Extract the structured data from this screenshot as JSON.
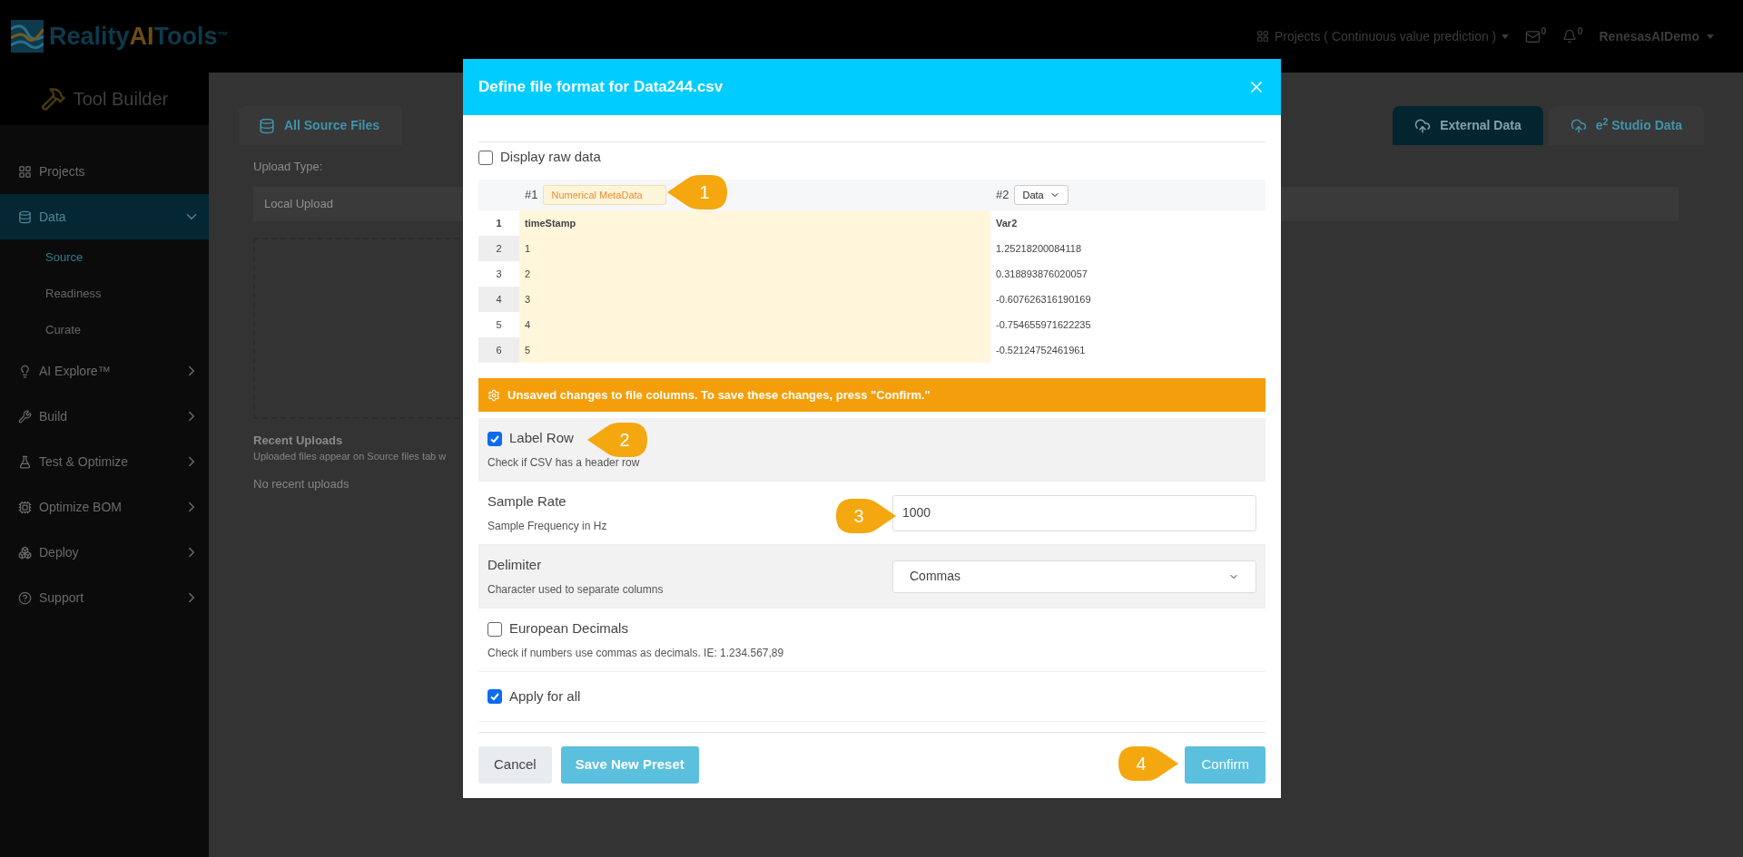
{
  "header": {
    "logo": {
      "parts": [
        "Reality",
        "AI",
        "Tools"
      ],
      "mark": "™"
    },
    "project_menu": "Projects ( Continuous value prediction )",
    "mail_count": "0",
    "notification_count": "0",
    "user": "RenesasAIDemo"
  },
  "sidebar": {
    "title": "Tool Builder",
    "items": [
      {
        "label": "Projects",
        "kind": "plain",
        "selected": false
      },
      {
        "label": "Data",
        "kind": "group",
        "selected": true,
        "expanded": true,
        "children": [
          {
            "label": "Source",
            "selected": true
          },
          {
            "label": "Readiness",
            "selected": false
          },
          {
            "label": "Curate",
            "selected": false
          }
        ]
      },
      {
        "label": "AI Explore™",
        "kind": "group",
        "selected": false,
        "expanded": false
      },
      {
        "label": "Build",
        "kind": "group",
        "selected": false,
        "expanded": false
      },
      {
        "label": "Test & Optimize",
        "kind": "group",
        "selected": false,
        "expanded": false
      },
      {
        "label": "Optimize BOM",
        "kind": "group",
        "selected": false,
        "expanded": false
      },
      {
        "label": "Deploy",
        "kind": "group",
        "selected": false,
        "expanded": false
      },
      {
        "label": "Support",
        "kind": "group",
        "selected": false,
        "expanded": false
      }
    ]
  },
  "page": {
    "source_tab": "All Source Files",
    "upload_type_label": "Upload Type:",
    "upload_type": "Local Upload",
    "recent_title": "Recent Uploads",
    "recent_note": "Uploaded files appear on Source files tab w",
    "recent_empty": "No recent uploads",
    "tabs": [
      {
        "label": "External Data",
        "selected": true
      },
      {
        "label": "e$^{2}$ Studio Data",
        "selected": false
      }
    ]
  },
  "dialog": {
    "title": "Define file format for Data244.csv",
    "display_raw": {
      "label": "Display raw data",
      "checked": false
    },
    "columns": [
      {
        "number": "#1",
        "type": "Numerical MetaData",
        "highlighted": true
      },
      {
        "number": "#2",
        "type": "Data",
        "highlighted": false
      }
    ],
    "rows": [
      {
        "index": "1",
        "header": true,
        "cells": [
          "timeStamp",
          "Var2"
        ]
      },
      {
        "index": "2",
        "header": false,
        "cells": [
          "1",
          "1.25218200084118"
        ]
      },
      {
        "index": "3",
        "header": false,
        "cells": [
          "2",
          "0.318893876020057"
        ]
      },
      {
        "index": "4",
        "header": false,
        "cells": [
          "3",
          "-0.607626316190169"
        ]
      },
      {
        "index": "5",
        "header": false,
        "cells": [
          "4",
          "-0.754655971622235"
        ]
      },
      {
        "index": "6",
        "header": false,
        "cells": [
          "5",
          "-0.52124752461961"
        ]
      }
    ],
    "warning": "Unsaved changes to file columns. To save these changes, press \"Confirm.\"",
    "settings": [
      {
        "kind": "checkbox",
        "label": "Label Row",
        "hint": "Check if CSV has a header row",
        "checked": true
      },
      {
        "kind": "input",
        "label": "Sample Rate",
        "hint": "Sample Frequency in Hz",
        "value": "1000"
      },
      {
        "kind": "select",
        "label": "Delimiter",
        "hint": "Character used to separate columns",
        "value": "Commas"
      },
      {
        "kind": "checkbox",
        "label": "European Decimals",
        "hint": "Check if numbers use commas as decimals. IE: 1.234.567,89",
        "checked": false
      },
      {
        "kind": "checkbox",
        "label": "Apply for all",
        "checked": true
      }
    ],
    "buttons": {
      "cancel": "Cancel",
      "save_preset": "Save New Preset",
      "confirm": "Confirm"
    }
  },
  "callouts": [
    {
      "number": "1"
    },
    {
      "number": "2"
    },
    {
      "number": "3"
    },
    {
      "number": "4"
    }
  ]
}
